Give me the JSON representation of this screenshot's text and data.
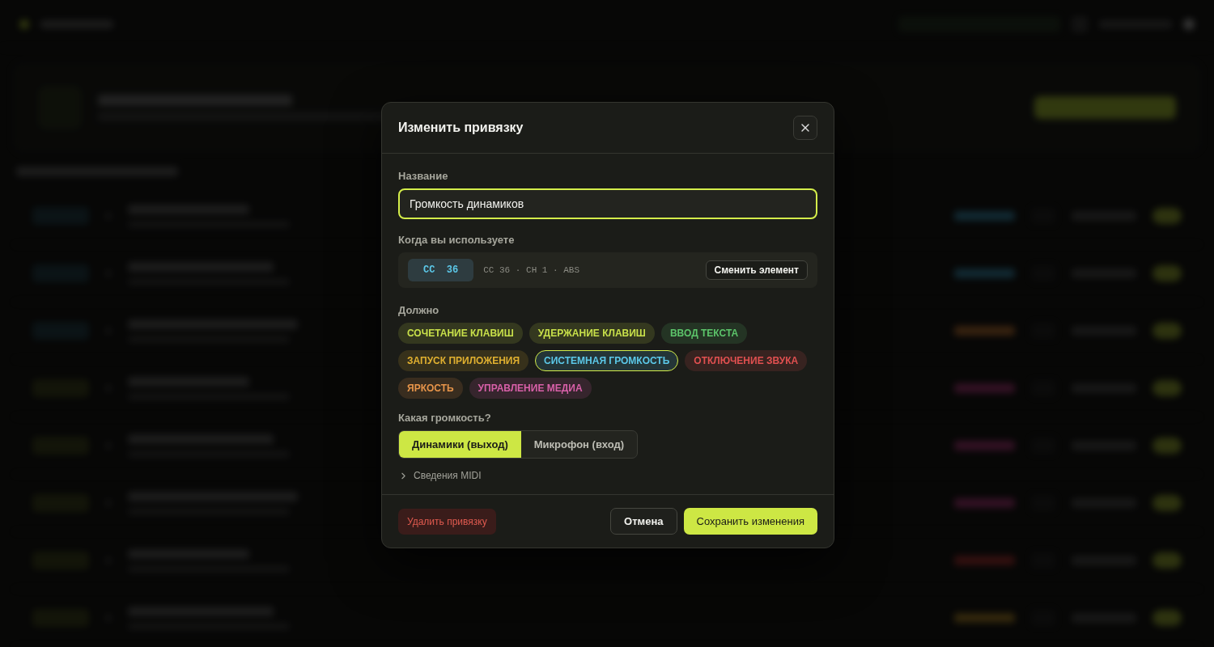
{
  "dialog": {
    "title": "Изменить привязку",
    "name_field": {
      "label": "Название",
      "value": "Громкость динамиков",
      "focused": true
    },
    "trigger": {
      "label": "Когда вы используете",
      "badge": "CC  36",
      "detail": "CC 36 · CH 1 · ABS",
      "button": "Сменить элемент"
    },
    "actions": {
      "label": "Должно",
      "items": [
        {
          "label": "СОЧЕТАНИЕ КЛАВИШ",
          "color": "#c8e04a",
          "selected": false
        },
        {
          "label": "УДЕРЖАНИЕ КЛАВИШ",
          "color": "#c8e04a",
          "selected": false
        },
        {
          "label": "ВВОД ТЕКСТА",
          "color": "#5cc46a",
          "selected": false
        },
        {
          "label": "ЗАПУСК ПРИЛОЖЕНИЯ",
          "color": "#e0b030",
          "selected": false
        },
        {
          "label": "СИСТЕМНАЯ ГРОМКОСТЬ",
          "color": "#5cc8e8",
          "selected": true
        },
        {
          "label": "ОТКЛЮЧЕНИЕ ЗВУКА",
          "color": "#e05050",
          "selected": false
        },
        {
          "label": "ЯРКОСТЬ",
          "color": "#e8954a",
          "selected": false
        },
        {
          "label": "УПРАВЛЕНИЕ МЕДИА",
          "color": "#d860a8",
          "selected": false
        }
      ]
    },
    "volume": {
      "label": "Какая громкость?",
      "options": [
        {
          "label": "Динамики (выход)",
          "selected": true
        },
        {
          "label": "Микрофон (вход)",
          "selected": false
        }
      ]
    },
    "midi_details": {
      "label": "Сведения MIDI",
      "expanded": false
    },
    "footer": {
      "delete": "Удалить привязку",
      "cancel": "Отмена",
      "save": "Сохранить изменения"
    }
  }
}
